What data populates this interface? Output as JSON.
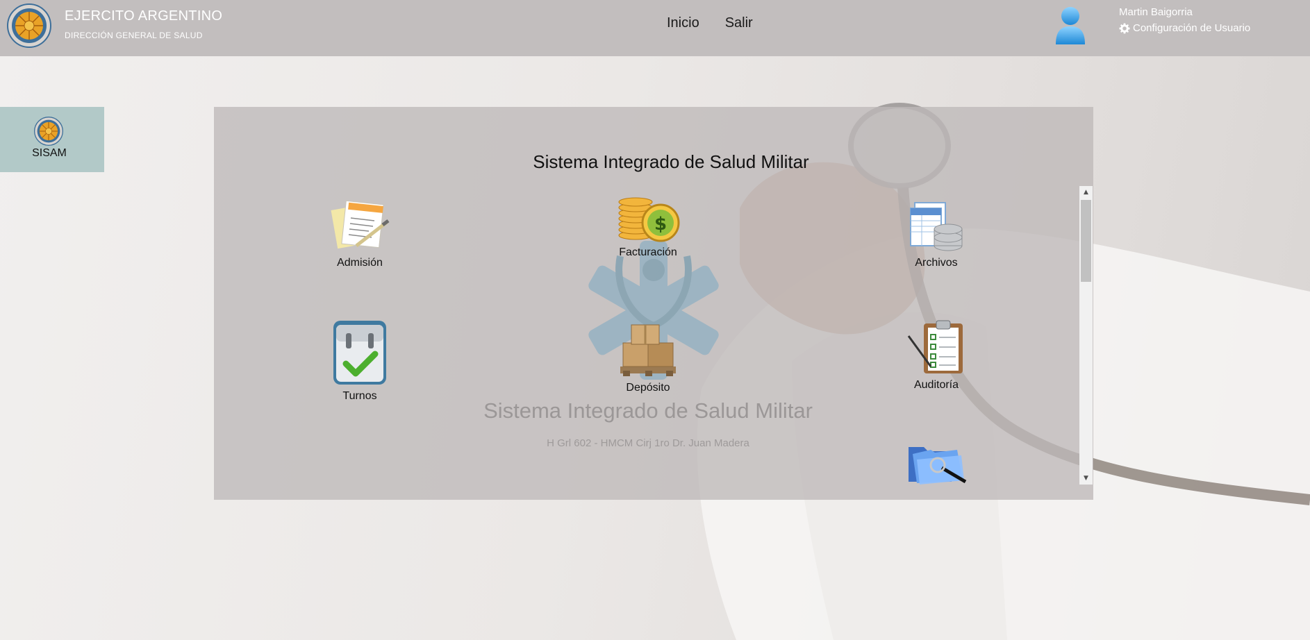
{
  "header": {
    "org_title": "EJERCITO ARGENTINO",
    "org_subtitle": "DIRECCIÓN GENERAL DE SALUD",
    "nav": {
      "home": "Inicio",
      "logout": "Salir"
    },
    "user": {
      "name": "Martin Baigorria",
      "config_label": "Configuración de Usuario",
      "config_icon": "gear-icon",
      "avatar_icon": "user-avatar-icon"
    }
  },
  "sidebar": {
    "label": "SISAM"
  },
  "main": {
    "title": "Sistema Integrado de Salud Militar",
    "watermark_title": "Sistema Integrado de Salud Militar",
    "watermark_subtitle": "H Grl 602 - HMCM Cirj 1ro Dr. Juan Madera",
    "modules": [
      {
        "label": "Admisión",
        "icon": "documents-pen-icon"
      },
      {
        "label": "Facturación",
        "icon": "coins-dollar-icon"
      },
      {
        "label": "Archivos",
        "icon": "files-database-icon"
      },
      {
        "label": "Turnos",
        "icon": "calendar-check-icon"
      },
      {
        "label": "Depósito",
        "icon": "boxes-pallet-icon"
      },
      {
        "label": "Auditoría",
        "icon": "clipboard-checklist-icon"
      },
      {
        "label": "",
        "icon": "folder-search-icon"
      }
    ]
  },
  "colors": {
    "header_bg": "#c2bebe",
    "sidebar_tile_bg": "#b2c9c8",
    "panel_bg": "#bebab9"
  }
}
